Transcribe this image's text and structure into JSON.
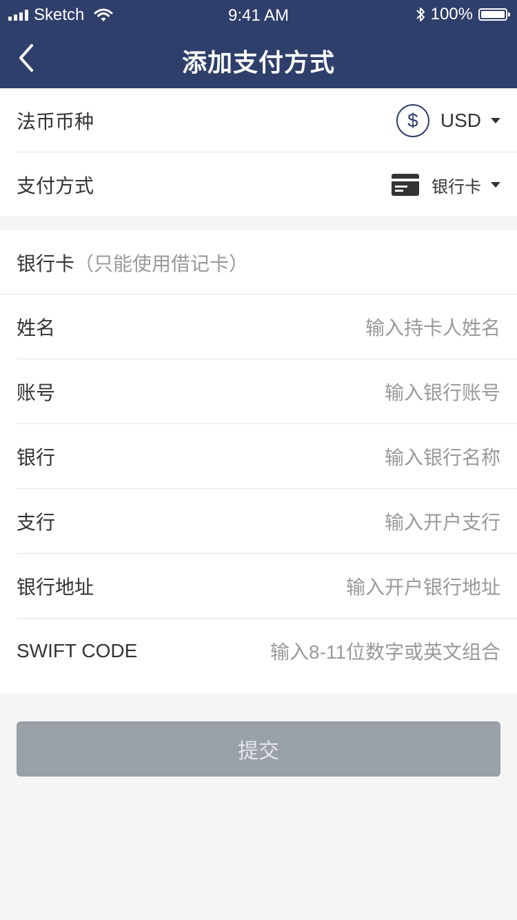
{
  "status_bar": {
    "carrier": "Sketch",
    "time": "9:41 AM",
    "battery": "100%"
  },
  "header": {
    "title": "添加支付方式"
  },
  "top_section": {
    "currency": {
      "label": "法币币种",
      "value": "USD",
      "icon": "dollar-circle-icon"
    },
    "payment_method": {
      "label": "支付方式",
      "value": "银行卡",
      "icon": "bank-card-icon"
    }
  },
  "bank_section": {
    "title": "银行卡",
    "title_hint": "（只能使用借记卡）",
    "fields": [
      {
        "label": "姓名",
        "placeholder": "输入持卡人姓名"
      },
      {
        "label": "账号",
        "placeholder": "输入银行账号"
      },
      {
        "label": "银行",
        "placeholder": "输入银行名称"
      },
      {
        "label": "支行",
        "placeholder": "输入开户支行"
      },
      {
        "label": "银行地址",
        "placeholder": "输入开户银行地址"
      },
      {
        "label": "SWIFT CODE",
        "placeholder": "输入8-11位数字或英文组合"
      }
    ]
  },
  "submit_label": "提交",
  "colors": {
    "header_bg": "#2f3f6b",
    "submit_bg": "#9aa0a8",
    "page_bg": "#f5f5f5"
  }
}
